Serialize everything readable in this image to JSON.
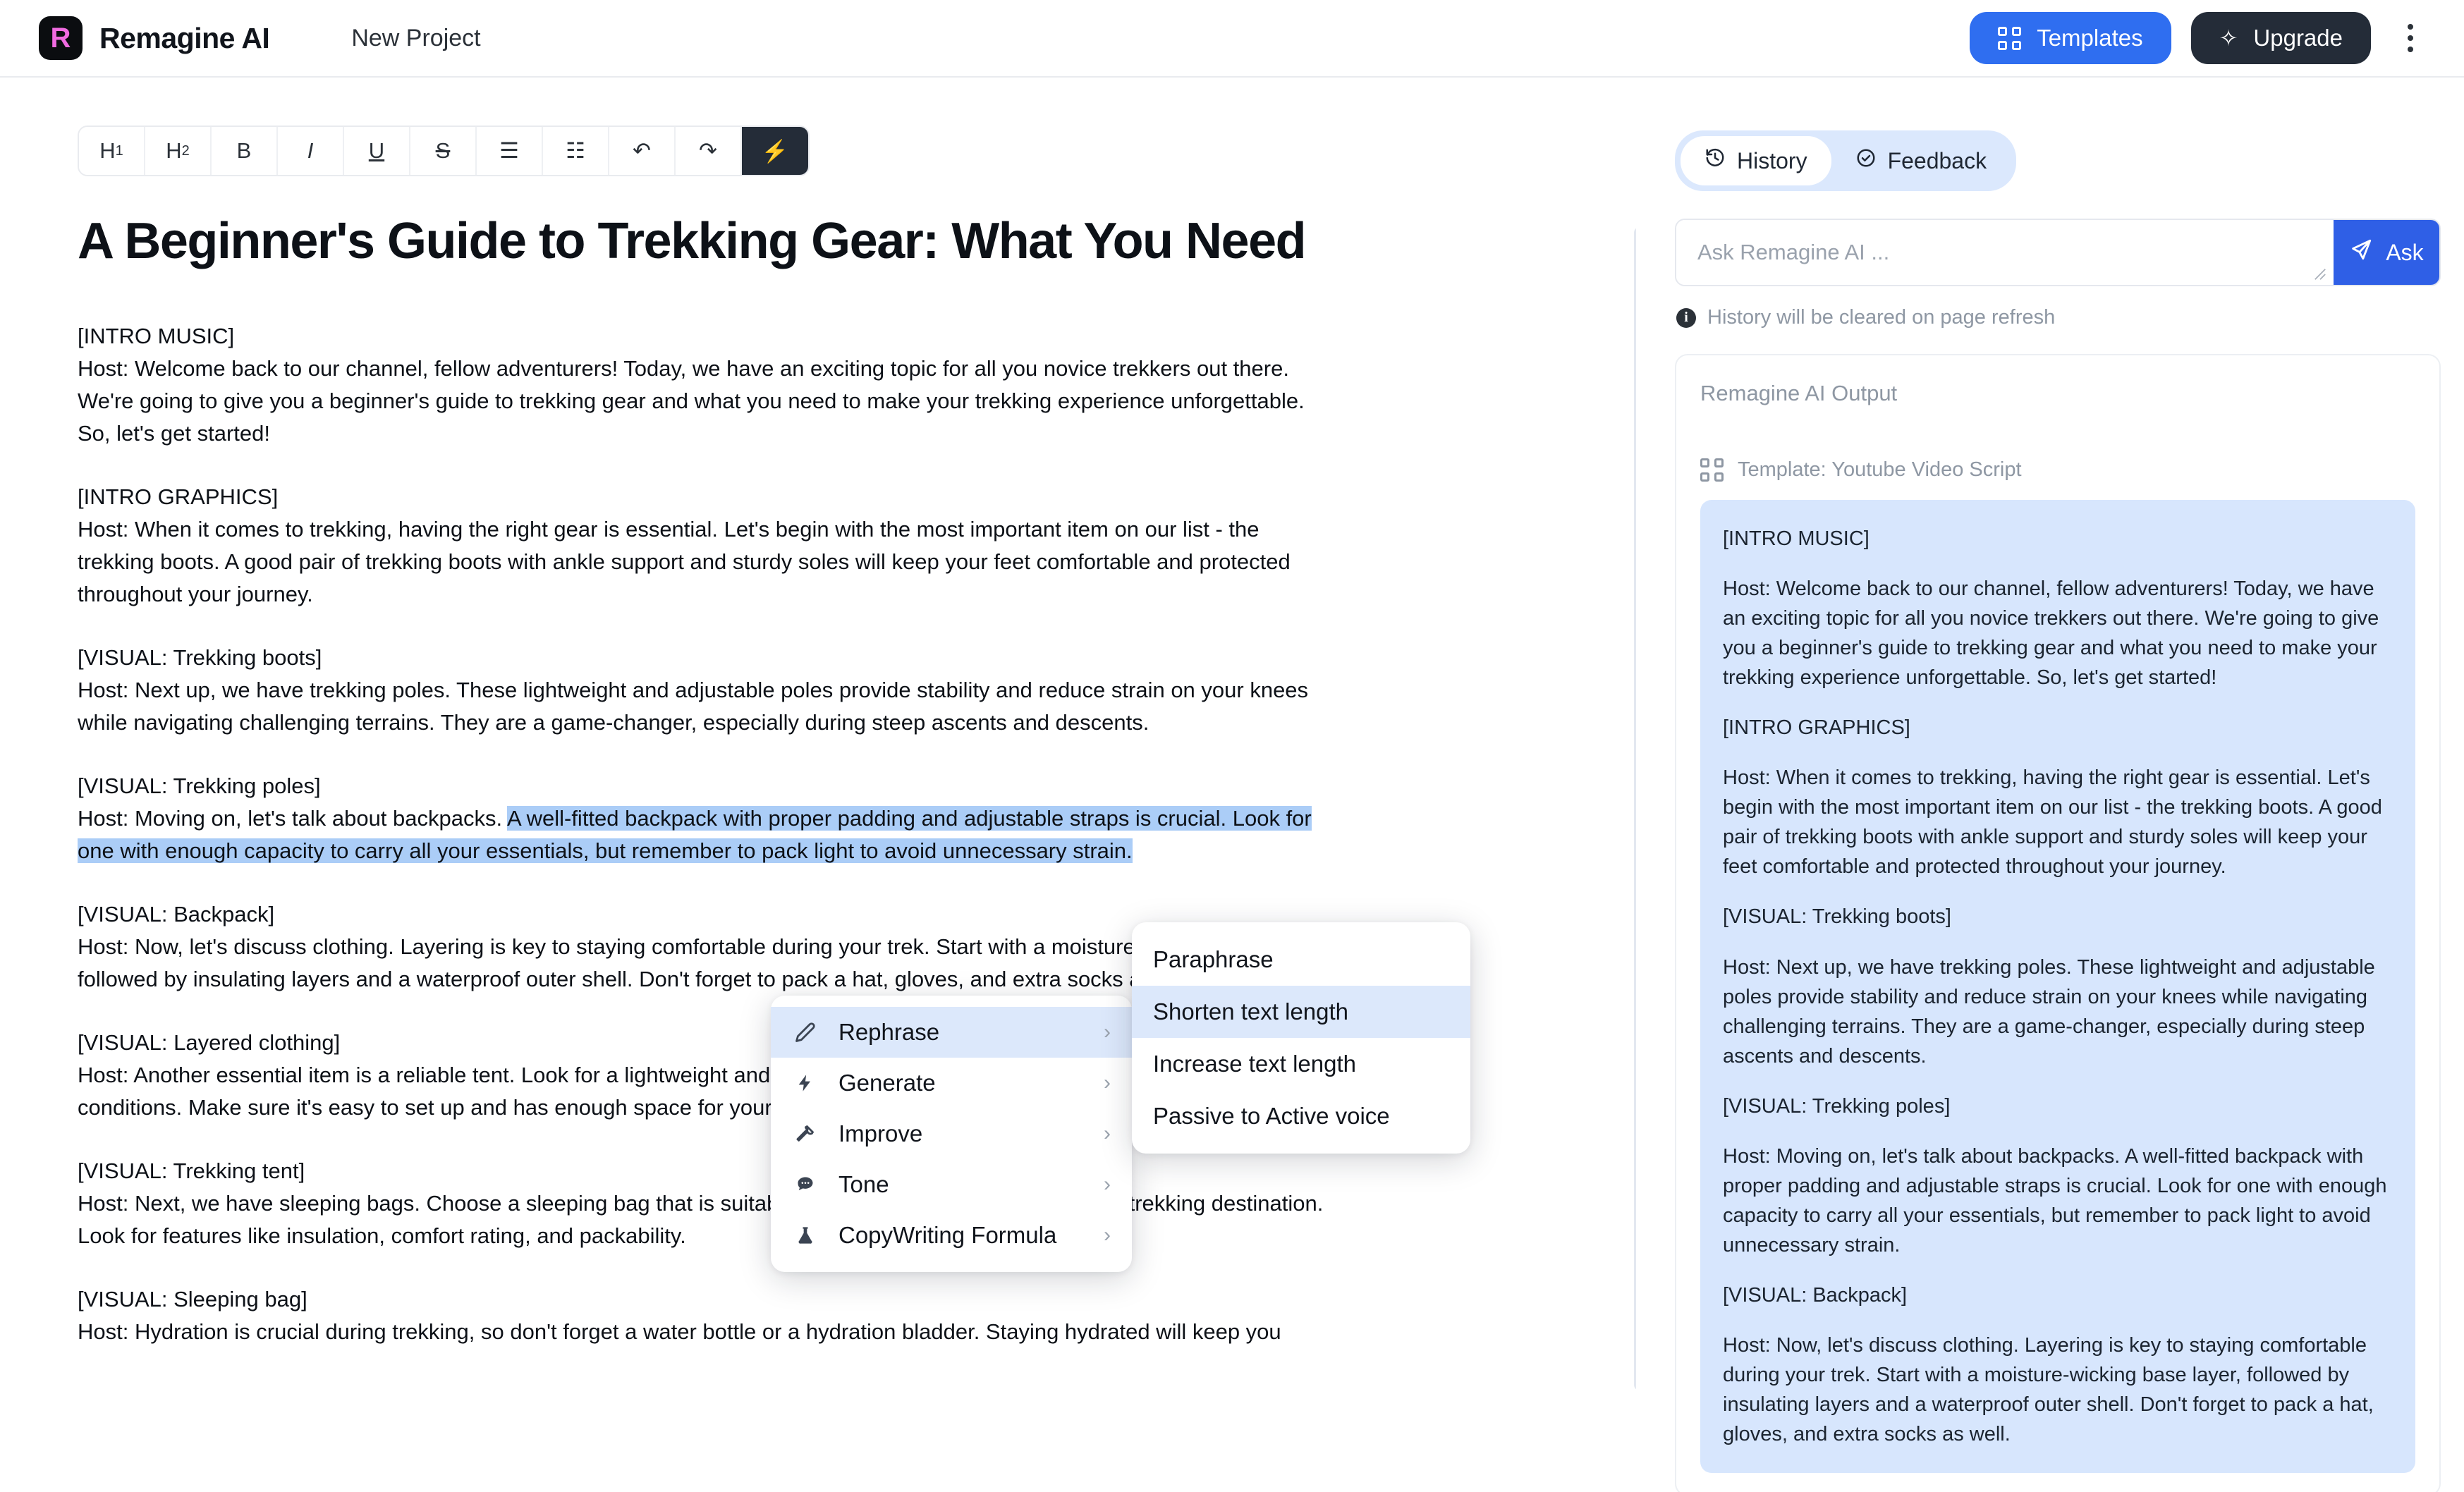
{
  "header": {
    "logo_letter": "R",
    "brand": "Remagine AI",
    "project_name": "New Project",
    "templates_label": "Templates",
    "upgrade_label": "Upgrade",
    "menu_icon": "kebab-menu-icon"
  },
  "toolbar": {
    "buttons": [
      {
        "name": "heading-1",
        "label": "H",
        "sub": "1"
      },
      {
        "name": "heading-2",
        "label": "H",
        "sub": "2"
      },
      {
        "name": "bold",
        "label": "B",
        "sub": ""
      },
      {
        "name": "italic",
        "label": "I",
        "sub": ""
      },
      {
        "name": "underline",
        "label": "U",
        "sub": ""
      },
      {
        "name": "strikethrough",
        "label": "S",
        "sub": ""
      },
      {
        "name": "bullet-list",
        "label": "☰",
        "sub": ""
      },
      {
        "name": "numbered-list",
        "label": "☷",
        "sub": ""
      },
      {
        "name": "undo",
        "label": "↶",
        "sub": ""
      },
      {
        "name": "redo",
        "label": "↷",
        "sub": ""
      },
      {
        "name": "ai-actions",
        "label": "⚡",
        "sub": ""
      }
    ]
  },
  "document": {
    "title": "A Beginner's Guide to Trekking Gear: What You Need",
    "p_intro_music": "[INTRO MUSIC]",
    "p_intro_1": "Host: Welcome back to our channel, fellow adventurers! Today, we have an exciting topic for all you novice trekkers out there.",
    "p_intro_2": "We're going to give you a beginner's guide to trekking gear and what you need to make your trekking experience unforgettable.",
    "p_intro_3": "So, let's get started!",
    "p_intro_graphics": "[INTRO GRAPHICS]",
    "p_boots_1": "Host: When it comes to trekking, having the right gear is essential. Let's begin with the most important item on our list - the",
    "p_boots_2": "trekking boots. A good pair of trekking boots with ankle support and sturdy soles will keep your feet comfortable and protected",
    "p_boots_3": "throughout your journey.",
    "p_visual_boots": "[VISUAL: Trekking boots]",
    "p_poles_1": "Host: Next up, we have trekking poles. These lightweight and adjustable poles provide stability and reduce strain on your knees",
    "p_poles_2": "while navigating challenging terrains. They are a game-changer, especially during steep ascents and descents.",
    "p_visual_poles": "[VISUAL: Trekking poles]",
    "p_backpack_lead": "Host: Moving on, let's talk about backpacks. ",
    "p_backpack_sel_1": "A well-fitted backpack with proper padding and adjustable straps is crucial. Look for",
    "p_backpack_sel_2": "one with enough capacity to carry all your essentials, but remember to pack light to avoid unnecessary strain.",
    "p_visual_backpack": "[VISUAL: Backpack]",
    "p_clothing_1": "Host: Now, let's discuss clothing. Layering is key to staying comfortable during your trek. Start with a moisture-wicking base layer,",
    "p_clothing_2": "followed by insulating layers and a waterproof outer shell. Don't forget to pack a hat, gloves, and extra socks as well.",
    "p_visual_clothing": "[VISUAL: Layered clothing]",
    "p_tent_1": "Host: Another essential item is a reliable tent. Look for a lightweight and durable tent that can withstand different weather",
    "p_tent_2": "conditions. Make sure it's easy to set up and has enough space for your needs.",
    "p_visual_tent": "[VISUAL: Trekking tent]",
    "p_sleeping_1": "Host: Next, we have sleeping bags. Choose a sleeping bag that is suitable for the temperature range of your trekking destination.",
    "p_sleeping_2": "Look for features like insulation, comfort rating, and packability.",
    "p_visual_sleeping": "[VISUAL: Sleeping bag]",
    "p_hydration_1": "Host: Hydration is crucial during trekking, so don't forget a water bottle or a hydration bladder. Staying hydrated will keep you"
  },
  "context_menu": {
    "items": [
      {
        "label": "Rephrase",
        "icon": "pencil-icon",
        "glyph": "✎",
        "active": true
      },
      {
        "label": "Generate",
        "icon": "lightning-icon",
        "glyph": "⚡",
        "active": false
      },
      {
        "label": "Improve",
        "icon": "wrench-icon",
        "glyph": "🔧",
        "active": false
      },
      {
        "label": "Tone",
        "icon": "chat-bubble-icon",
        "glyph": "💬",
        "active": false
      },
      {
        "label": "CopyWriting Formula",
        "icon": "flask-icon",
        "glyph": "⚗",
        "active": false
      }
    ],
    "arrow": "›"
  },
  "context_submenu": {
    "items": [
      {
        "label": "Paraphrase",
        "active": false
      },
      {
        "label": "Shorten text length",
        "active": true
      },
      {
        "label": "Increase text length",
        "active": false
      },
      {
        "label": "Passive to Active voice",
        "active": false
      }
    ]
  },
  "right_panel": {
    "tabs": [
      {
        "label": "History",
        "icon": "history-clock-icon",
        "glyph": "↺",
        "active": true
      },
      {
        "label": "Feedback",
        "icon": "check-circle-icon",
        "glyph": "✓",
        "active": false
      }
    ],
    "ask_placeholder": "Ask Remagine AI ...",
    "ask_value": "",
    "ask_button": "Ask",
    "send_icon": "send-paper-plane-icon",
    "hint": "History will be cleared on page refresh",
    "output_title": "Remagine AI Output",
    "template_label": "Template: Youtube Video Script",
    "template_icon": "grid-icon",
    "output_paragraphs": [
      "[INTRO MUSIC]",
      "Host: Welcome back to our channel, fellow adventurers! Today, we have an exciting topic for all you novice trekkers out there. We're going to give you a beginner's guide to trekking gear and what you need to make your trekking experience unforgettable. So, let's get started!",
      "[INTRO GRAPHICS]",
      "Host: When it comes to trekking, having the right gear is essential. Let's begin with the most important item on our list - the trekking boots. A good pair of trekking boots with ankle support and sturdy soles will keep your feet comfortable and protected throughout your journey.",
      "[VISUAL: Trekking boots]",
      "Host: Next up, we have trekking poles. These lightweight and adjustable poles provide stability and reduce strain on your knees while navigating challenging terrains. They are a game-changer, especially during steep ascents and descents.",
      "[VISUAL: Trekking poles]",
      "Host: Moving on, let's talk about backpacks. A well-fitted backpack with proper padding and adjustable straps is crucial. Look for one with enough capacity to carry all your essentials, but remember to pack light to avoid unnecessary strain.",
      "[VISUAL: Backpack]",
      "Host: Now, let's discuss clothing. Layering is key to staying comfortable during your trek. Start with a moisture-wicking base layer, followed by insulating layers and a waterproof outer shell. Don't forget to pack a hat, gloves, and extra socks as well."
    ]
  },
  "colors": {
    "accent_blue": "#2f6ef0",
    "dark": "#242c38",
    "selection": "#abcdf7",
    "output_bg": "#d7e6fd",
    "menu_active": "#dce8fb"
  }
}
